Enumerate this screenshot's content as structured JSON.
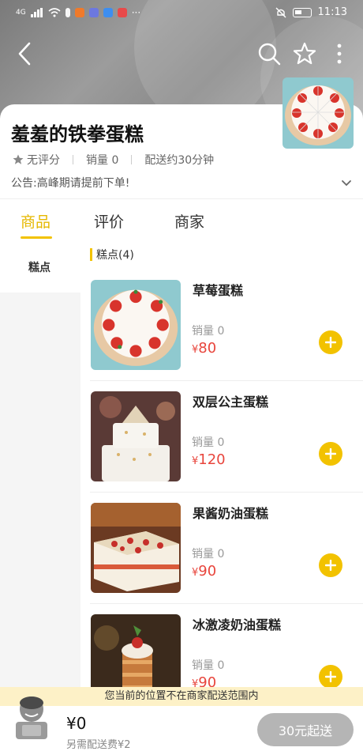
{
  "status_bar": {
    "time": "11:13",
    "signal": "4G"
  },
  "store": {
    "name": "羞羞的铁拳蛋糕",
    "rating": "无评分",
    "sales": "销量 0",
    "delivery_time": "配送约30分钟",
    "notice": "公告:高峰期请提前下单!"
  },
  "tabs": [
    {
      "label": "商品"
    },
    {
      "label": "评价"
    },
    {
      "label": "商家"
    }
  ],
  "sidebar": {
    "items": [
      {
        "label": "糕点"
      }
    ]
  },
  "category": {
    "title": "糕点(4)"
  },
  "products": [
    {
      "name": "草莓蛋糕",
      "sales": "销量 0",
      "currency": "¥",
      "price": "80"
    },
    {
      "name": "双层公主蛋糕",
      "sales": "销量 0",
      "currency": "¥",
      "price": "120"
    },
    {
      "name": "果酱奶油蛋糕",
      "sales": "销量 0",
      "currency": "¥",
      "price": "90"
    },
    {
      "name": "冰激凌奶油蛋糕",
      "sales": "销量 0",
      "currency": "¥",
      "price": "90"
    }
  ],
  "warning": "您当前的位置不在商家配送范围内",
  "cart": {
    "total": "¥0",
    "delivery_fee": "另需配送费¥2",
    "checkout_label": "30元起送"
  },
  "colors": {
    "accent": "#f2c200",
    "price": "#e8453c",
    "warning_bg": "#fdf1c7"
  }
}
